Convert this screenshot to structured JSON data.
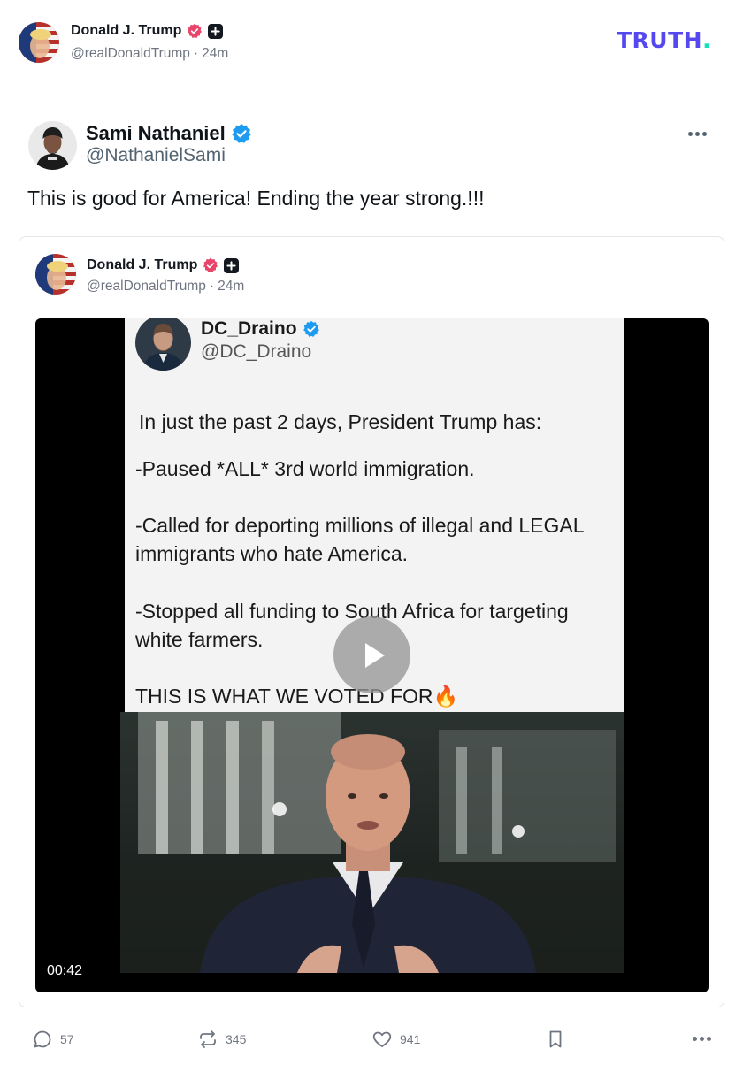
{
  "header": {
    "name": "Donald J. Trump",
    "handle": "@realDonaldTrump",
    "separator": "·",
    "time": "24m",
    "logo_text": "TRUTH",
    "logo_dot": "."
  },
  "embedded_post": {
    "name": "Sami Nathaniel",
    "handle": "@NathanielSami",
    "text": "This is good for America! Ending the year strong.!!!",
    "quote": {
      "name": "Donald J. Trump",
      "handle": "@realDonaldTrump",
      "separator": "·",
      "time": "24m",
      "video": {
        "duration": "00:42",
        "screenshot": {
          "name": "DC_Draino",
          "handle": "@DC_Draino",
          "lines": [
            "In just the past 2 days, President Trump has:",
            "-Paused *ALL* 3rd world immigration.",
            "-Called for deporting millions of illegal and LEGAL",
            "immigrants who hate America.",
            "-Stopped all funding to South Africa for targeting",
            "white farmers.",
            "THIS IS WHAT WE VOTED FOR🔥"
          ]
        }
      }
    }
  },
  "actions": {
    "replies": "57",
    "retruths": "345",
    "likes": "941"
  },
  "colors": {
    "truth_brand": "#5448ee",
    "truth_dot": "#17e0b8",
    "verified_truth": "#e8456b",
    "verified_x": "#1d9bf0"
  }
}
